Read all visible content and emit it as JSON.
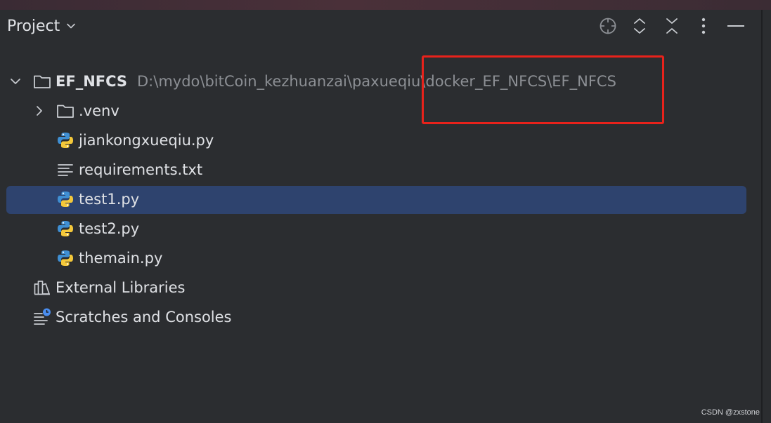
{
  "header": {
    "title": "Project",
    "toolbar": [
      "locate-icon",
      "expand-all-icon",
      "collapse-all-icon",
      "options-icon",
      "hide-icon"
    ]
  },
  "tree": {
    "root": {
      "name": "EF_NFCS",
      "path": "D:\\mydo\\bitCoin_kezhuanzai\\paxueqiu\\docker_EF_NFCS\\EF_NFCS",
      "expanded": true
    },
    "children": [
      {
        "name": ".venv",
        "type": "folder",
        "expanded": false
      },
      {
        "name": "jiankongxueqiu.py",
        "type": "python"
      },
      {
        "name": "requirements.txt",
        "type": "text"
      },
      {
        "name": "test1.py",
        "type": "python",
        "selected": true
      },
      {
        "name": "test2.py",
        "type": "python"
      },
      {
        "name": "themain.py",
        "type": "python"
      }
    ],
    "external_libraries": "External Libraries",
    "scratches": "Scratches and Consoles"
  },
  "colors": {
    "background": "#2b2d30",
    "selection": "#2e436e",
    "annotation_box": "#e8221b",
    "path_text": "#8c8f94"
  },
  "watermark": "CSDN @zxstone"
}
